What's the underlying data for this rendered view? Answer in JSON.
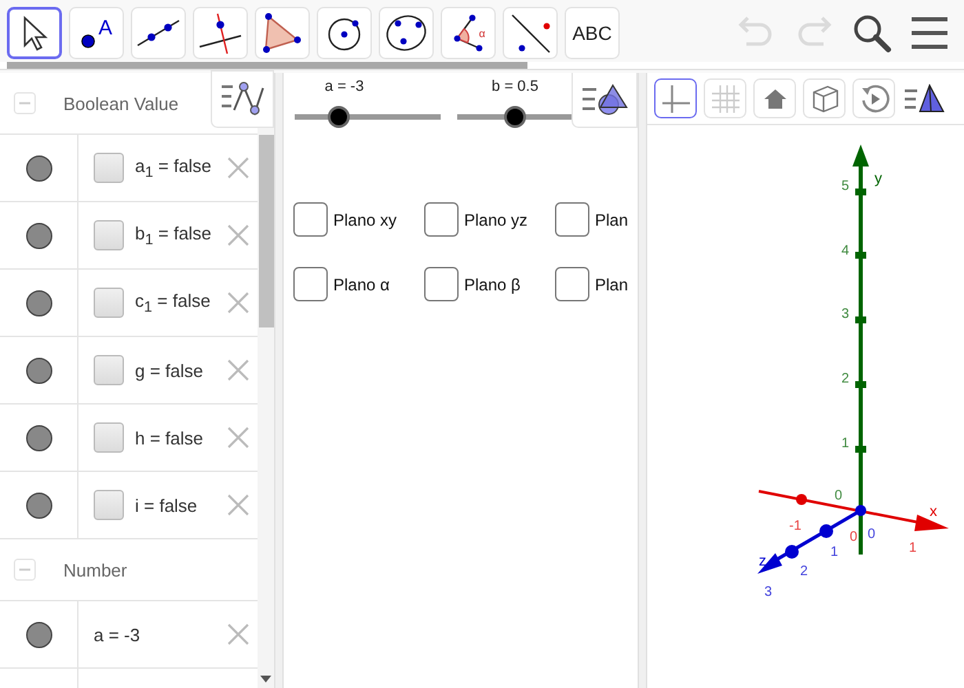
{
  "toolbar": {
    "tools": [
      {
        "kind": "move",
        "selected": true
      },
      {
        "kind": "point",
        "label": "A",
        "selected": false
      },
      {
        "kind": "line",
        "selected": false
      },
      {
        "kind": "perpendicular",
        "selected": false
      },
      {
        "kind": "polygon",
        "selected": false
      },
      {
        "kind": "circle",
        "selected": false
      },
      {
        "kind": "conic",
        "selected": false
      },
      {
        "kind": "angle",
        "label": "α",
        "selected": false
      },
      {
        "kind": "reflect",
        "selected": false
      },
      {
        "kind": "text",
        "label": "ABC",
        "selected": false
      }
    ],
    "actions": [
      {
        "kind": "undo",
        "disabled": true
      },
      {
        "kind": "redo",
        "disabled": true
      },
      {
        "kind": "search"
      },
      {
        "kind": "menu"
      }
    ]
  },
  "algebra": {
    "sections": [
      {
        "title": "Boolean Value",
        "expanded": true,
        "items": [
          {
            "kind": "boolean",
            "label": "a$_{1}$ = false",
            "visible": true,
            "checked": false
          },
          {
            "kind": "boolean",
            "label": "b$_{1}$ = false",
            "visible": true,
            "checked": false
          },
          {
            "kind": "boolean",
            "label": "c$_{1}$ = false",
            "visible": true,
            "checked": false
          },
          {
            "kind": "boolean",
            "label": "g = false",
            "visible": true,
            "checked": false
          },
          {
            "kind": "boolean",
            "label": "h = false",
            "visible": true,
            "checked": false
          },
          {
            "kind": "boolean",
            "label": "i = false",
            "visible": true,
            "checked": false
          }
        ]
      },
      {
        "title": "Number",
        "expanded": true,
        "items": [
          {
            "kind": "number",
            "label": "a = -3",
            "visible": true
          }
        ]
      }
    ]
  },
  "graphics": {
    "sliders": [
      {
        "label": "a = -3",
        "level": 0.3
      },
      {
        "label": "b = 0.5",
        "level": 0.5
      }
    ],
    "checkboxes": [
      {
        "label": "Plano xy",
        "checked": false
      },
      {
        "label": "Plano yz",
        "checked": false
      },
      {
        "label": "Plan",
        "checked": false
      },
      {
        "label": "Plano α",
        "checked": false
      },
      {
        "label": "Plano β",
        "checked": false
      },
      {
        "label": "Plan",
        "checked": false
      }
    ]
  },
  "view3d": {
    "buttons": [
      {
        "kind": "axes",
        "selected": true
      },
      {
        "kind": "grid",
        "selected": false
      },
      {
        "kind": "home",
        "selected": false
      },
      {
        "kind": "cube",
        "selected": false
      },
      {
        "kind": "rotate",
        "selected": false
      }
    ],
    "axes": [
      {
        "kind": "y",
        "label": "y",
        "ticks": [
          "5",
          "4",
          "3",
          "2",
          "1",
          "0"
        ]
      },
      {
        "kind": "x",
        "label": "x",
        "ticks": [
          "-1",
          "0",
          "1"
        ]
      },
      {
        "kind": "z",
        "label": "z",
        "ticks": [
          "0",
          "1",
          "2",
          "3"
        ]
      }
    ]
  }
}
